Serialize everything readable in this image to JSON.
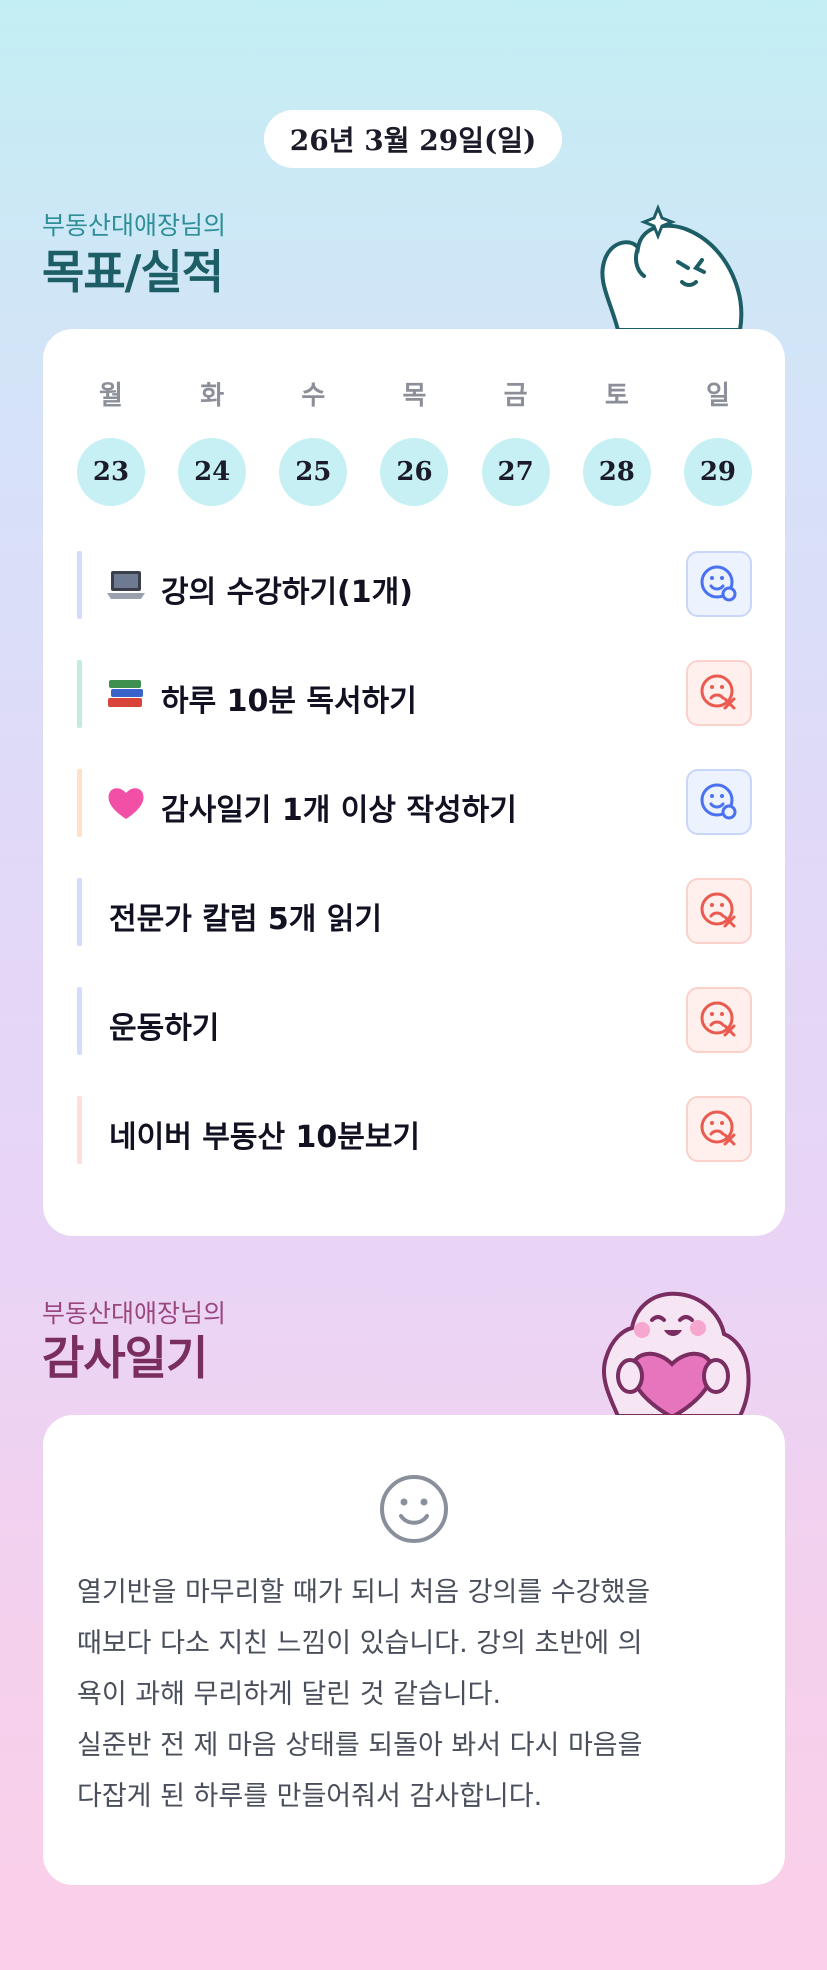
{
  "header": {
    "date": "26년 3월 29일(일)"
  },
  "goals_section": {
    "subtitle": "부동산대애장님의",
    "title": "목표/실적"
  },
  "week": {
    "days": [
      "월",
      "화",
      "수",
      "목",
      "금",
      "토",
      "일"
    ],
    "dates": [
      "23",
      "24",
      "25",
      "26",
      "27",
      "28",
      "29"
    ]
  },
  "goals": [
    {
      "emoji": "laptop-icon",
      "text": "강의 수강하기(1개)",
      "status": "done",
      "bar_color": "#d3ddfb"
    },
    {
      "emoji": "books-icon",
      "text": "하루 10분 독서하기",
      "status": "miss",
      "bar_color": "#bfeeda"
    },
    {
      "emoji": "heart-icon",
      "text": "감사일기 1개 이상 작성하기",
      "status": "done",
      "bar_color": "#ffe0c8"
    },
    {
      "emoji": "",
      "text": "전문가 칼럼 5개 읽기",
      "status": "miss",
      "bar_color": "#d3ddfb"
    },
    {
      "emoji": "",
      "text": "운동하기",
      "status": "miss",
      "bar_color": "#d3ddfb"
    },
    {
      "emoji": "",
      "text": "네이버 부동산 10분보기",
      "status": "miss",
      "bar_color": "#fde0da"
    }
  ],
  "diary_section": {
    "subtitle": "부동산대애장님의",
    "title": "감사일기"
  },
  "diary": {
    "mood_icon": "smile-icon",
    "text": "열기반을 마무리할 때가 되니 처음 강의를 수강했을\n때보다 다소 지친 느낌이 있습니다. 강의 초반에 의\n욕이 과해 무리하게 달린 것 같습니다.\n실준반 전 제 마음 상태를 되돌아 봐서 다시 마음을\n다잡게 된 하루를 만들어줘서 감사합니다."
  },
  "colors": {
    "done_icon": "#4a72f0",
    "miss_icon": "#ea5a4e",
    "title_teal": "#1d5e66",
    "title_plum": "#7a2d61"
  }
}
